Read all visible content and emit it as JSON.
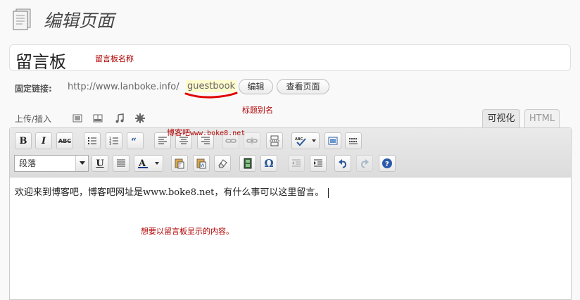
{
  "header": {
    "title": "编辑页面",
    "icon": "page-icon"
  },
  "post": {
    "title": "留言板",
    "title_annotation": "留言板名称"
  },
  "permalink": {
    "label": "固定链接:",
    "base_url": "http://www.lanboke.info/",
    "slug": "guestbook",
    "edit_button": "编辑",
    "view_button": "查看页面",
    "slug_annotation": "标题别名"
  },
  "media": {
    "label": "上传/插入",
    "icons": [
      "image-icon",
      "video-icon",
      "audio-icon",
      "media-icon"
    ]
  },
  "tabs": {
    "visual": "可视化",
    "html": "HTML"
  },
  "toolbar": {
    "row1": [
      "bold",
      "italic",
      "strikethrough",
      "bullet-list",
      "numbered-list",
      "blockquote",
      "align-left",
      "align-center",
      "align-right",
      "link",
      "unlink",
      "more",
      "spellcheck",
      "fullscreen",
      "kitchen-sink"
    ],
    "row2": [
      "format-select",
      "underline",
      "justify",
      "text-color",
      "paste-text",
      "paste-word",
      "remove-format",
      "media",
      "special-char",
      "outdent",
      "indent",
      "undo",
      "redo",
      "help"
    ],
    "bold_label": "B",
    "italic_label": "I",
    "strike_label": "ABC",
    "underline_label": "U",
    "omega_label": "Ω",
    "format_value": "段落"
  },
  "watermark": {
    "prefix": "博客吧",
    "site": "www.boke8.net"
  },
  "editor": {
    "content": "欢迎来到博客吧，博客吧网址是www.boke8.net，有什么事可以这里留言。",
    "content_annotation": "想要以留言板显示的内容。"
  },
  "colors": {
    "annotation": "#b00000",
    "slug_highlight": "#fffbcc",
    "underline_mark": "#e00000"
  }
}
